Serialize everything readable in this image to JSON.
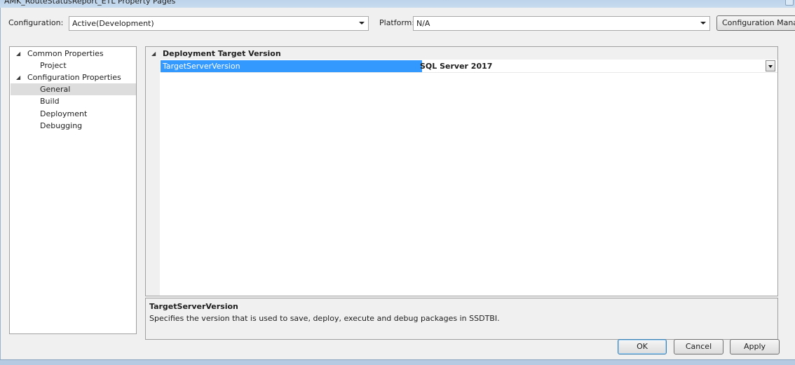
{
  "window": {
    "title": "AMK_RouteStatusReport_ETL Property Pages"
  },
  "toolbar": {
    "configuration_label": "Configuration:",
    "configuration_value": "Active(Development)",
    "platform_label": "Platform:",
    "platform_value": "N/A",
    "configuration_manager_label": "Configuration Mana"
  },
  "tree": {
    "items": [
      {
        "label": "Common Properties",
        "expanded": true
      },
      {
        "label": "Project"
      },
      {
        "label": "Configuration Properties",
        "expanded": true
      },
      {
        "label": "General",
        "selected": true
      },
      {
        "label": "Build"
      },
      {
        "label": "Deployment"
      },
      {
        "label": "Debugging"
      }
    ],
    "expanded_glyph": "◢"
  },
  "grid": {
    "category": "Deployment Target Version",
    "property_name": "TargetServerVersion",
    "property_value": "SQL Server 2017"
  },
  "description": {
    "title": "TargetServerVersion",
    "text": "Specifies the version that is used to save, deploy, execute and debug packages in SSDTBI."
  },
  "buttons": {
    "ok": "OK",
    "cancel": "Cancel",
    "apply": "Apply"
  },
  "colors": {
    "selection": "#3399ff",
    "tree_selection": "#dddddd",
    "window_bg": "#f0f0f0"
  },
  "icons": {
    "dropdown": "chevron-down-icon",
    "expander": "collapse-triangle-icon"
  }
}
